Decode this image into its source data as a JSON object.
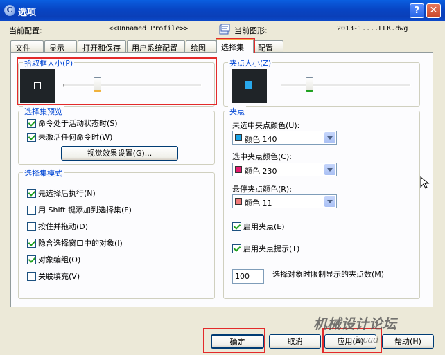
{
  "window": {
    "title": "选项",
    "help_glyph": "?",
    "close_glyph": "✕"
  },
  "header": {
    "profile_label": "当前配置:",
    "profile_value": "<<Unnamed Profile>>",
    "drawing_label": "当前图形:",
    "drawing_value": "2013-1....LLK.dwg"
  },
  "tabs": [
    "文件",
    "显示",
    "打开和保存",
    "用户系统配置",
    "绘图",
    "选择集",
    "配置"
  ],
  "active_tab": "选择集",
  "pickbox": {
    "title": "拾取框大小(P)",
    "slider_level": 0.25
  },
  "grip_size": {
    "title": "夹点大小(Z)",
    "slider_level": 0.22
  },
  "selection_preview": {
    "title": "选择集预览",
    "options": [
      {
        "label": "命令处于活动状态时(S)",
        "checked": true
      },
      {
        "label": "未激活任何命令时(W)",
        "checked": true
      }
    ],
    "visual_button": "视觉效果设置(G)..."
  },
  "selection_modes": {
    "title": "选择集模式",
    "options": [
      {
        "label": "先选择后执行(N)",
        "checked": true
      },
      {
        "label": "用 Shift 键添加到选择集(F)",
        "checked": false
      },
      {
        "label": "按住并拖动(D)",
        "checked": false
      },
      {
        "label": "隐含选择窗口中的对象(I)",
        "checked": true
      },
      {
        "label": "对象编组(O)",
        "checked": true
      },
      {
        "label": "关联填充(V)",
        "checked": false
      }
    ]
  },
  "grips": {
    "title": "夹点",
    "unselected_label": "未选中夹点颜色(U):",
    "unselected_color": {
      "text": "颜色 140",
      "hex": "#1aa4e6"
    },
    "selected_label": "选中夹点颜色(C):",
    "selected_color": {
      "text": "颜色 230",
      "hex": "#e6196e"
    },
    "hover_label": "悬停夹点颜色(R):",
    "hover_color": {
      "text": "颜色 11",
      "hex": "#f07a7a"
    },
    "enable_grips": {
      "label": "启用夹点(E)",
      "checked": true
    },
    "enable_tips": {
      "label": "启用夹点提示(T)",
      "checked": true
    },
    "limit_value": "100",
    "limit_label": "选择对象时限制显示的夹点数(M)"
  },
  "footer": {
    "ok": "确定",
    "cancel": "取消",
    "apply": "应用(A)",
    "help": "帮助(H)"
  },
  "watermark": {
    "line1": "机械设计论坛",
    "line2": "jxcad"
  }
}
